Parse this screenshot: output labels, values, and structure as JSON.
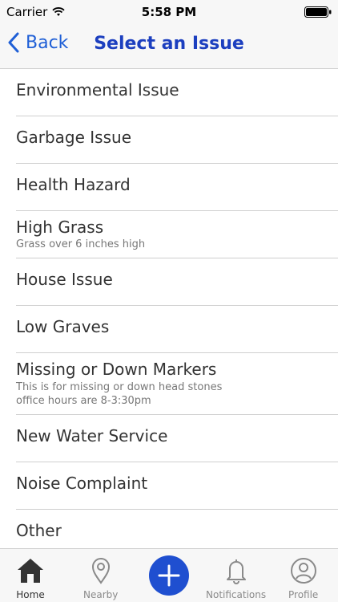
{
  "status": {
    "carrier": "Carrier",
    "time": "5:58 PM"
  },
  "nav": {
    "back_label": "Back",
    "title": "Select an Issue"
  },
  "items": [
    {
      "label": "Environmental Issue"
    },
    {
      "label": "Garbage Issue"
    },
    {
      "label": "Health Hazard"
    },
    {
      "label": "High Grass",
      "desc": "Grass over 6 inches high"
    },
    {
      "label": "House Issue"
    },
    {
      "label": "Low Graves"
    },
    {
      "label": "Missing or Down Markers",
      "desc1": "This is for missing or down head stones",
      "desc2": "office hours are 8-3:30pm"
    },
    {
      "label": "New Water Service"
    },
    {
      "label": "Noise Complaint"
    },
    {
      "label": "Other"
    }
  ],
  "tabs": {
    "home": "Home",
    "nearby": "Nearby",
    "notifications": "Notifications",
    "profile": "Profile"
  },
  "colors": {
    "accent": "#1f4fd0",
    "title": "#1c3fbf"
  }
}
